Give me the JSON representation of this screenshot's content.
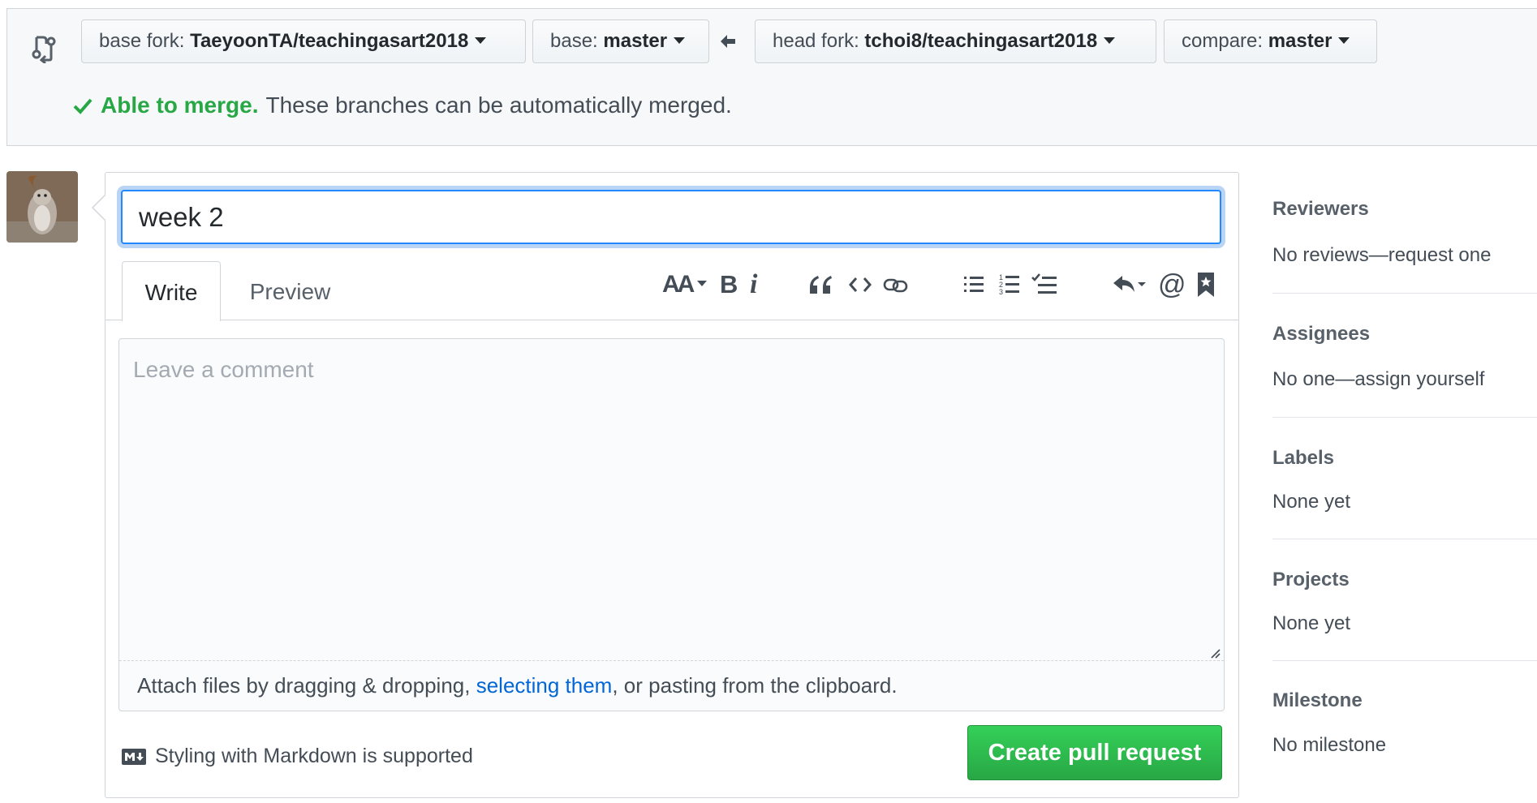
{
  "compare": {
    "base_fork": {
      "label": "base fork:",
      "value": "TaeyoonTA/teachingasart2018"
    },
    "base": {
      "label": "base:",
      "value": "master"
    },
    "head_fork": {
      "label": "head fork:",
      "value": "tchoi8/teachingasart2018"
    },
    "compare": {
      "label": "compare:",
      "value": "master"
    },
    "merge_status": {
      "ok": "Able to merge.",
      "message": "These branches can be automatically merged."
    }
  },
  "form": {
    "title_value": "week 2",
    "tabs": {
      "write": "Write",
      "preview": "Preview"
    },
    "toolbar": {
      "header": "AA",
      "bold": "B",
      "italic": "i",
      "mention": "@"
    },
    "comment_placeholder": "Leave a comment",
    "attach": {
      "before": "Attach files by dragging & dropping, ",
      "link": "selecting them",
      "after": ", or pasting from the clipboard."
    },
    "markdown_note": "Styling with Markdown is supported",
    "submit_label": "Create pull request"
  },
  "sidebar": {
    "reviewers": {
      "heading": "Reviewers",
      "value": "No reviews—request one"
    },
    "assignees": {
      "heading": "Assignees",
      "value": "No one—assign yourself"
    },
    "labels": {
      "heading": "Labels",
      "value": "None yet"
    },
    "projects": {
      "heading": "Projects",
      "value": "None yet"
    },
    "milestone": {
      "heading": "Milestone",
      "value": "No milestone"
    }
  },
  "colors": {
    "success": "#28a745",
    "link": "#0366d6",
    "focus": "#2188ff"
  },
  "icons": [
    "compare-icon",
    "arrow-left-icon",
    "check-icon",
    "bold-icon",
    "italic-icon",
    "quote-icon",
    "code-icon",
    "link-icon",
    "unordered-list-icon",
    "ordered-list-icon",
    "task-list-icon",
    "reply-icon",
    "mention-icon",
    "bookmark-icon",
    "markdown-icon"
  ]
}
